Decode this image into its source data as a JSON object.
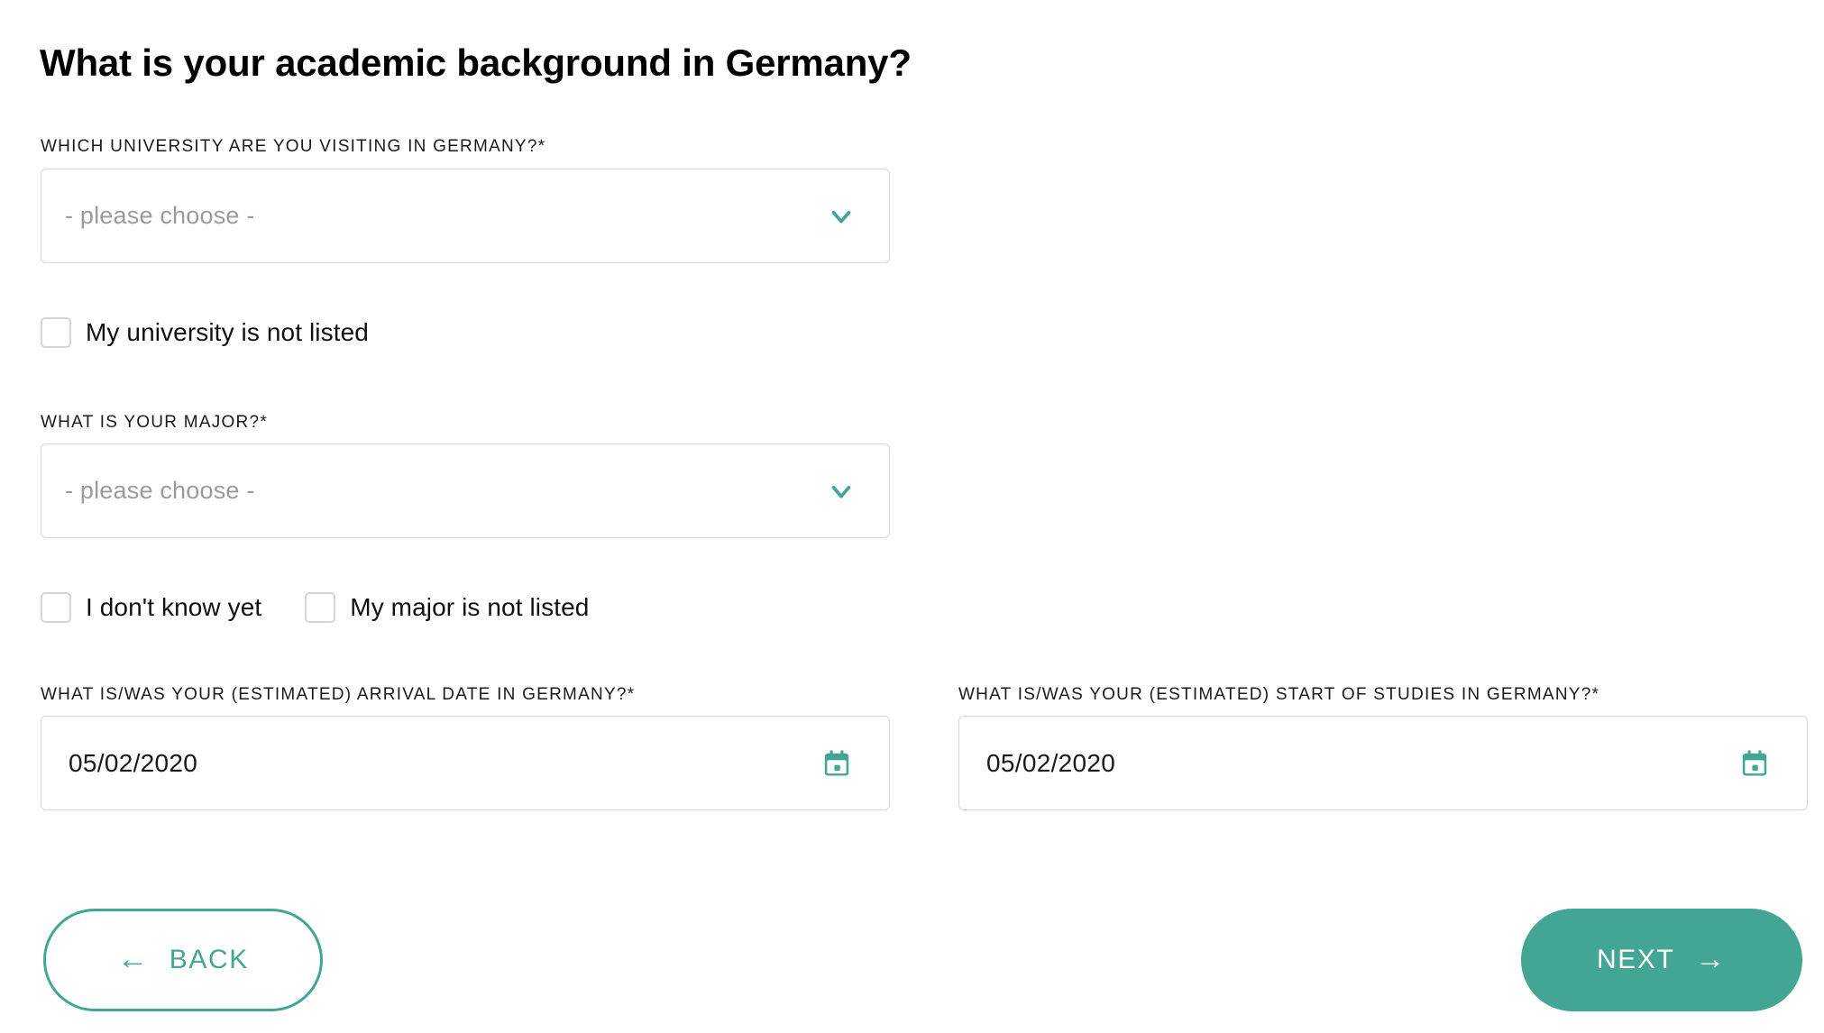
{
  "page": {
    "title": "What is your academic background in Germany?"
  },
  "fields": {
    "university": {
      "label": "WHICH UNIVERSITY ARE YOU VISITING IN GERMANY?*",
      "value": "- please choose -",
      "icon": "chevron-down-icon",
      "checkbox": {
        "label": "My university is not listed",
        "checked": false
      }
    },
    "major": {
      "label": "WHAT IS YOUR MAJOR?*",
      "value": "- please choose -",
      "icon": "chevron-down-icon",
      "checkboxes": [
        {
          "label": "I don't know yet",
          "checked": false
        },
        {
          "label": "My major is not listed",
          "checked": false
        }
      ]
    },
    "arrival_date": {
      "label": "WHAT IS/WAS YOUR (ESTIMATED) ARRIVAL DATE IN GERMANY?*",
      "value": "05/02/2020",
      "icon": "calendar-icon"
    },
    "start_of_studies": {
      "label": "WHAT IS/WAS YOUR (ESTIMATED) START OF STUDIES IN GERMANY?*",
      "value": "05/02/2020",
      "icon": "calendar-icon"
    }
  },
  "navigation": {
    "back": {
      "label": "BACK",
      "icon": "arrow-left-icon",
      "glyph": "←"
    },
    "next": {
      "label": "NEXT",
      "icon": "arrow-right-icon",
      "glyph": "→"
    }
  },
  "colors": {
    "accent": "#43a695",
    "border": "#d8d8d8",
    "placeholder": "#9b9b9b",
    "text": "#111111"
  }
}
